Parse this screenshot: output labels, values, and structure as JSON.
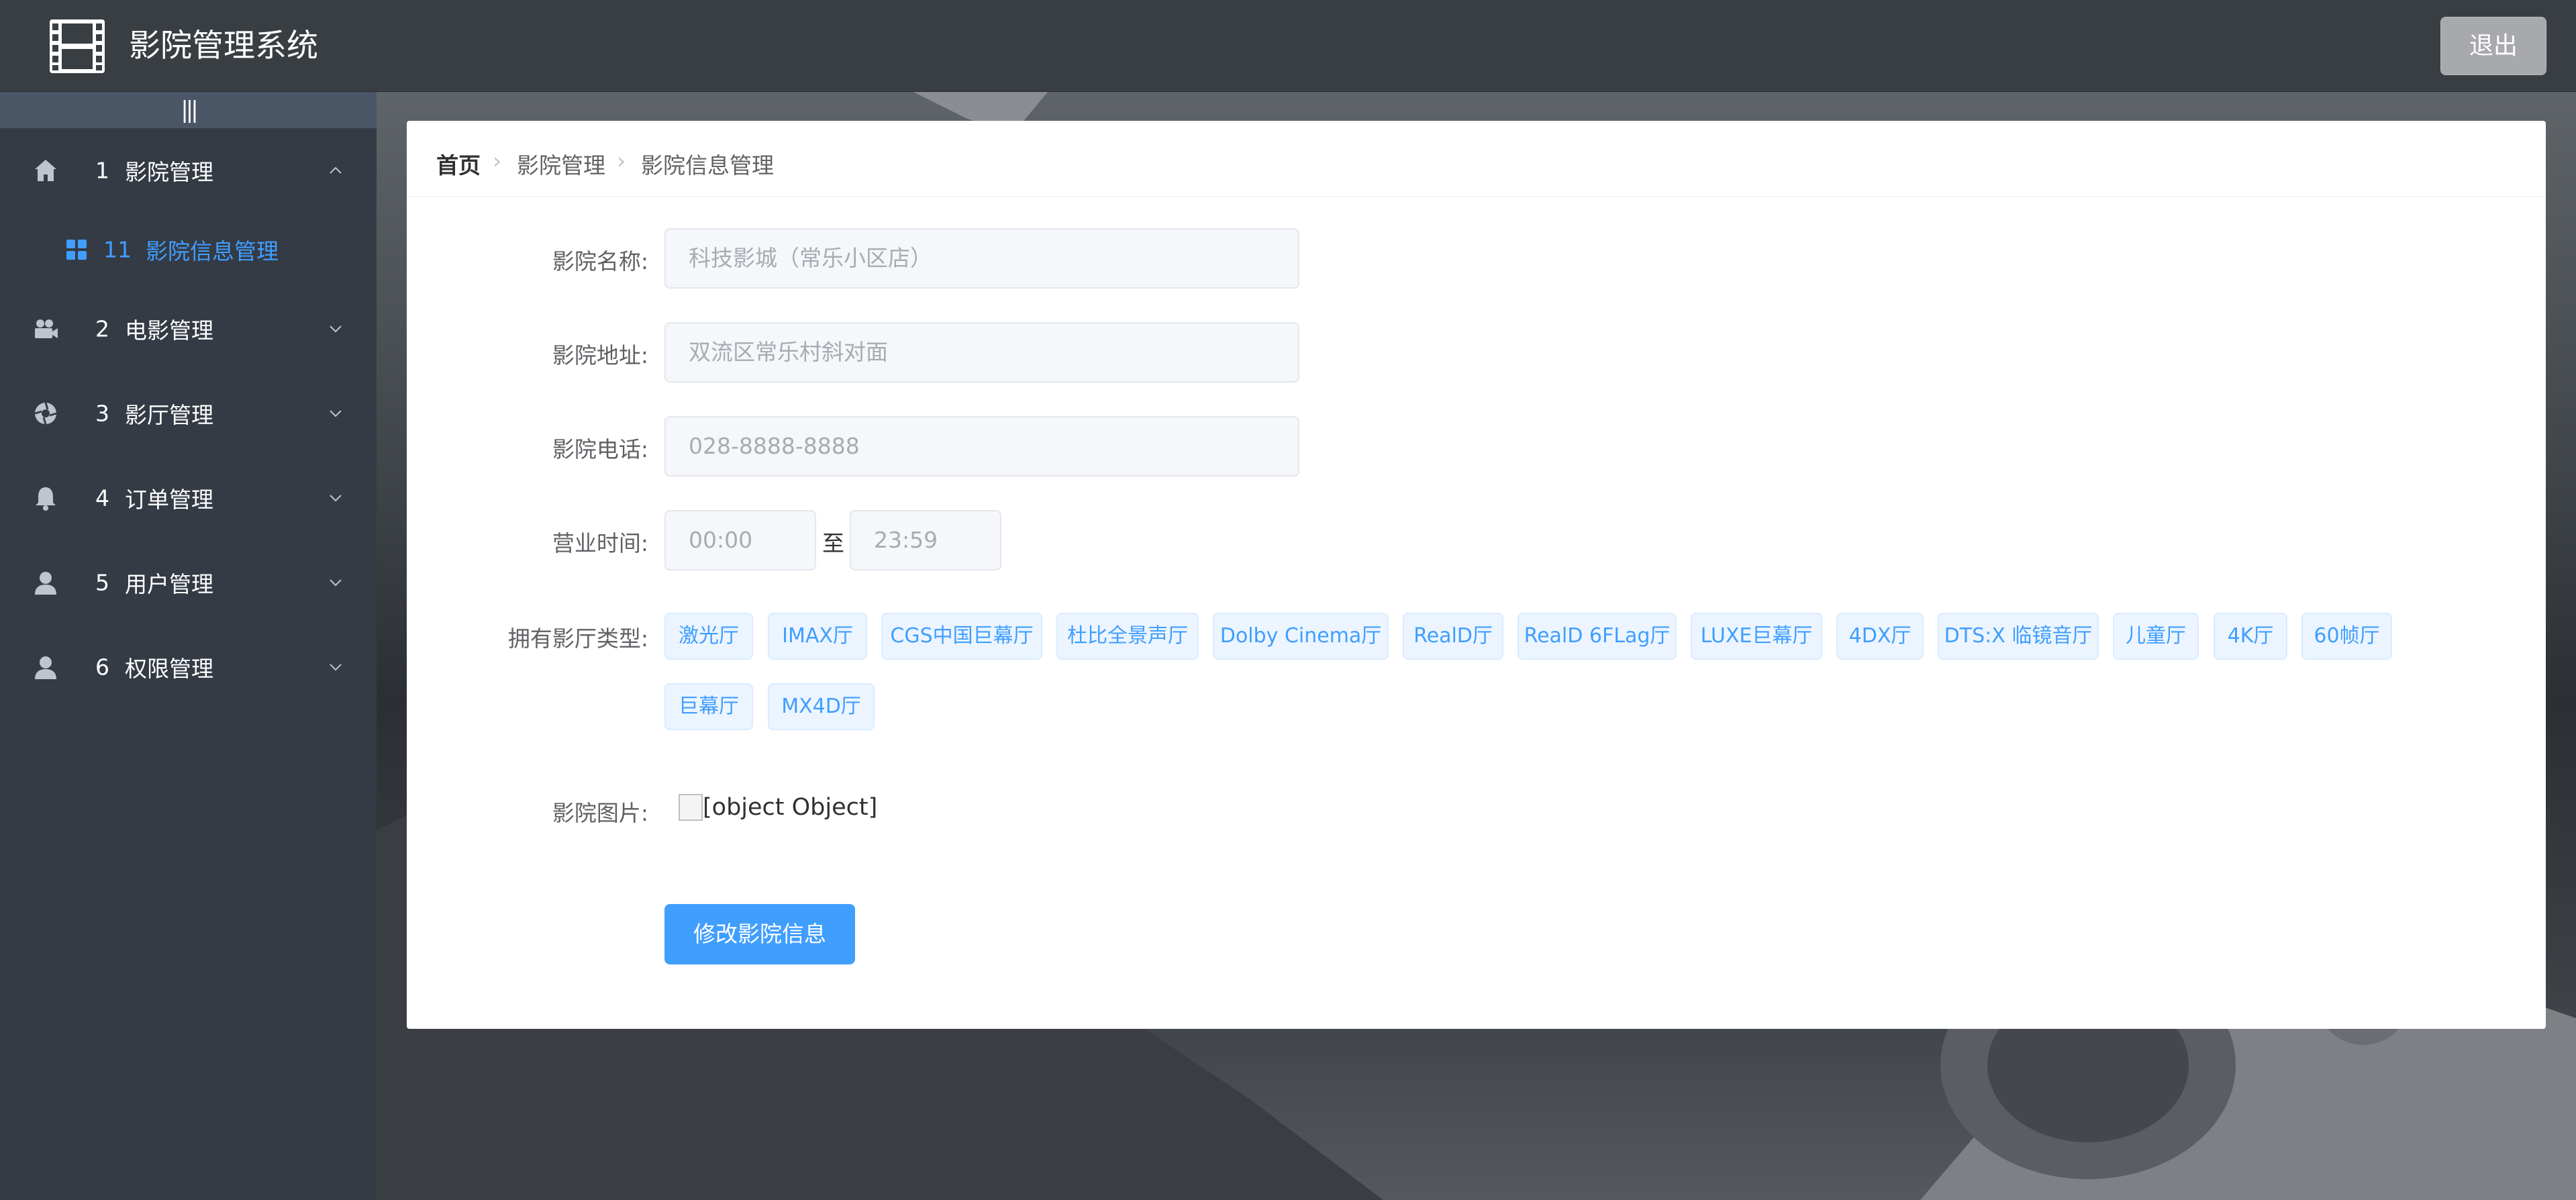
{
  "header": {
    "title": "影院管理系统",
    "logout_label": "退出",
    "logo_icon": "film-strip-icon"
  },
  "sidebar": {
    "collapse_label": "|||",
    "menu": [
      {
        "num": "1",
        "label": "影院管理",
        "icon": "home-icon",
        "expanded": true
      },
      {
        "num": "2",
        "label": "电影管理",
        "icon": "camera-icon",
        "expanded": false
      },
      {
        "num": "3",
        "label": "影厅管理",
        "icon": "aperture-icon",
        "expanded": false
      },
      {
        "num": "4",
        "label": "订单管理",
        "icon": "bell-icon",
        "expanded": false
      },
      {
        "num": "5",
        "label": "用户管理",
        "icon": "user-icon",
        "expanded": false
      },
      {
        "num": "6",
        "label": "权限管理",
        "icon": "user-icon",
        "expanded": false
      }
    ],
    "submenu": {
      "num": "11",
      "label": "影院信息管理",
      "icon": "grid-icon",
      "active": true
    }
  },
  "breadcrumb": [
    "首页",
    "影院管理",
    "影院信息管理"
  ],
  "form": {
    "name_label": "影院名称:",
    "name_placeholder": "科技影城（常乐小区店）",
    "address_label": "影院地址:",
    "address_placeholder": "双流区常乐村斜对面",
    "phone_label": "影院电话:",
    "phone_placeholder": "028-8888-8888",
    "hours_label": "营业时间:",
    "hours_start_placeholder": "00:00",
    "hours_to": "至",
    "hours_end_placeholder": "23:59",
    "hall_types_label": "拥有影厅类型:",
    "hall_types": [
      "激光厅",
      "IMAX厅",
      "CGS中国巨幕厅",
      "杜比全景声厅",
      "Dolby Cinema厅",
      "RealD厅",
      "RealD 6FLag厅",
      "LUXE巨幕厅",
      "4DX厅",
      "DTS:X 临镜音厅",
      "儿童厅",
      "4K厅",
      "60帧厅",
      "巨幕厅",
      "MX4D厅"
    ],
    "image_label": "影院图片:",
    "image_alt": "[object Object]",
    "submit_label": "修改影院信息"
  },
  "colors": {
    "accent": "#409eff",
    "sidebar_bg": "#343b45",
    "header_bg": "#393e43"
  }
}
